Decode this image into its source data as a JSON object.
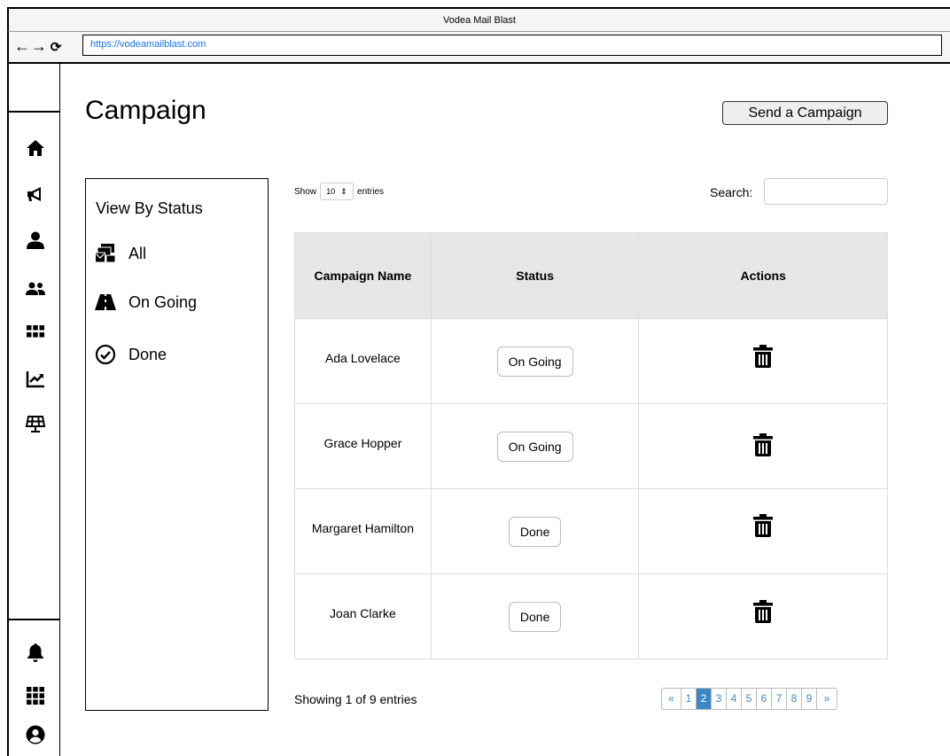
{
  "browser": {
    "window_title": "Vodea Mail Blast",
    "url": "https://vodeamailblast.com",
    "nav": {
      "back": "←",
      "forward": "→",
      "reload": "⟳"
    }
  },
  "sidebar": {
    "icons": [
      "home-icon",
      "megaphone-icon",
      "user-icon",
      "users-icon",
      "apps-icon",
      "chart-icon",
      "solar-panel-icon"
    ],
    "bottom_icons": [
      "bell-icon",
      "grid-icon",
      "account-icon"
    ]
  },
  "header": {
    "title": "Campaign",
    "send_button": "Send a Campaign"
  },
  "status_panel": {
    "heading": "View By Status",
    "items": [
      {
        "label": "All",
        "icon": "mail-bulk-icon"
      },
      {
        "label": "On Going",
        "icon": "road-icon"
      },
      {
        "label": "Done",
        "icon": "check-circle-icon"
      }
    ]
  },
  "table_controls": {
    "show_label": "Show",
    "entries_value": "10",
    "entries_label": "entries",
    "search_label": "Search:",
    "search_value": ""
  },
  "table": {
    "headers": [
      "Campaign Name",
      "Status",
      "Actions"
    ],
    "rows": [
      {
        "name": "Ada Lovelace",
        "status": "On Going"
      },
      {
        "name": "Grace Hopper",
        "status": "On Going"
      },
      {
        "name": "Margaret Hamilton",
        "status": "Done"
      },
      {
        "name": "Joan Clarke",
        "status": "Done"
      }
    ]
  },
  "footer": {
    "showing": "Showing 1 of 9 entries",
    "pagination": {
      "prev": "«",
      "next": "»",
      "pages": [
        "1",
        "2",
        "3",
        "4",
        "5",
        "6",
        "7",
        "8",
        "9"
      ],
      "active": "2"
    }
  },
  "colors": {
    "accent": "#3d86c6",
    "header_bg": "#e6e6e6",
    "link": "#1a73e8"
  }
}
